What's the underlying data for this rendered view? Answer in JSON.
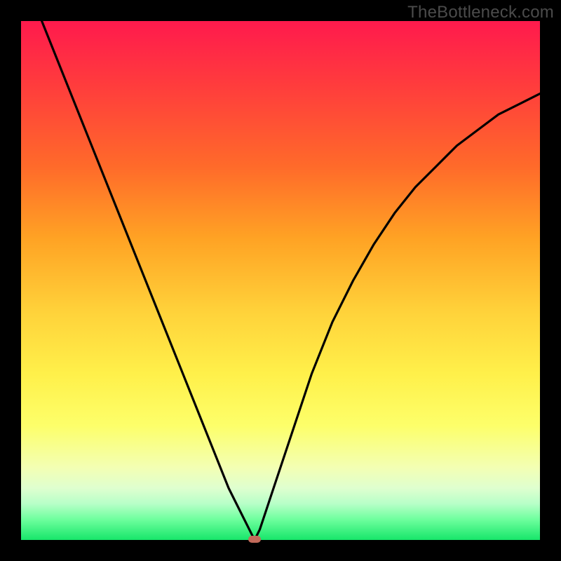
{
  "watermark": "TheBottleneck.com",
  "colors": {
    "frame": "#000000",
    "curve": "#000000",
    "marker": "#c26a5a"
  },
  "chart_data": {
    "type": "line",
    "title": "",
    "xlabel": "",
    "ylabel": "",
    "xlim": [
      0,
      100
    ],
    "ylim": [
      0,
      100
    ],
    "grid": false,
    "legend": false,
    "series": [
      {
        "name": "bottleneck-curve",
        "x": [
          0,
          4,
          8,
          12,
          16,
          20,
          24,
          28,
          32,
          36,
          40,
          42,
          44,
          45,
          46,
          48,
          52,
          56,
          60,
          64,
          68,
          72,
          76,
          80,
          84,
          88,
          92,
          96,
          100
        ],
        "y": [
          112,
          100,
          90,
          80,
          70,
          60,
          50,
          40,
          30,
          20,
          10,
          6,
          2,
          0,
          2,
          8,
          20,
          32,
          42,
          50,
          57,
          63,
          68,
          72,
          76,
          79,
          82,
          84,
          86
        ]
      }
    ],
    "marker": {
      "x": 45,
      "y": 0
    },
    "background_gradient": {
      "top": "#ff1a4d",
      "mid": "#fff04a",
      "bottom": "#17e66a"
    }
  }
}
